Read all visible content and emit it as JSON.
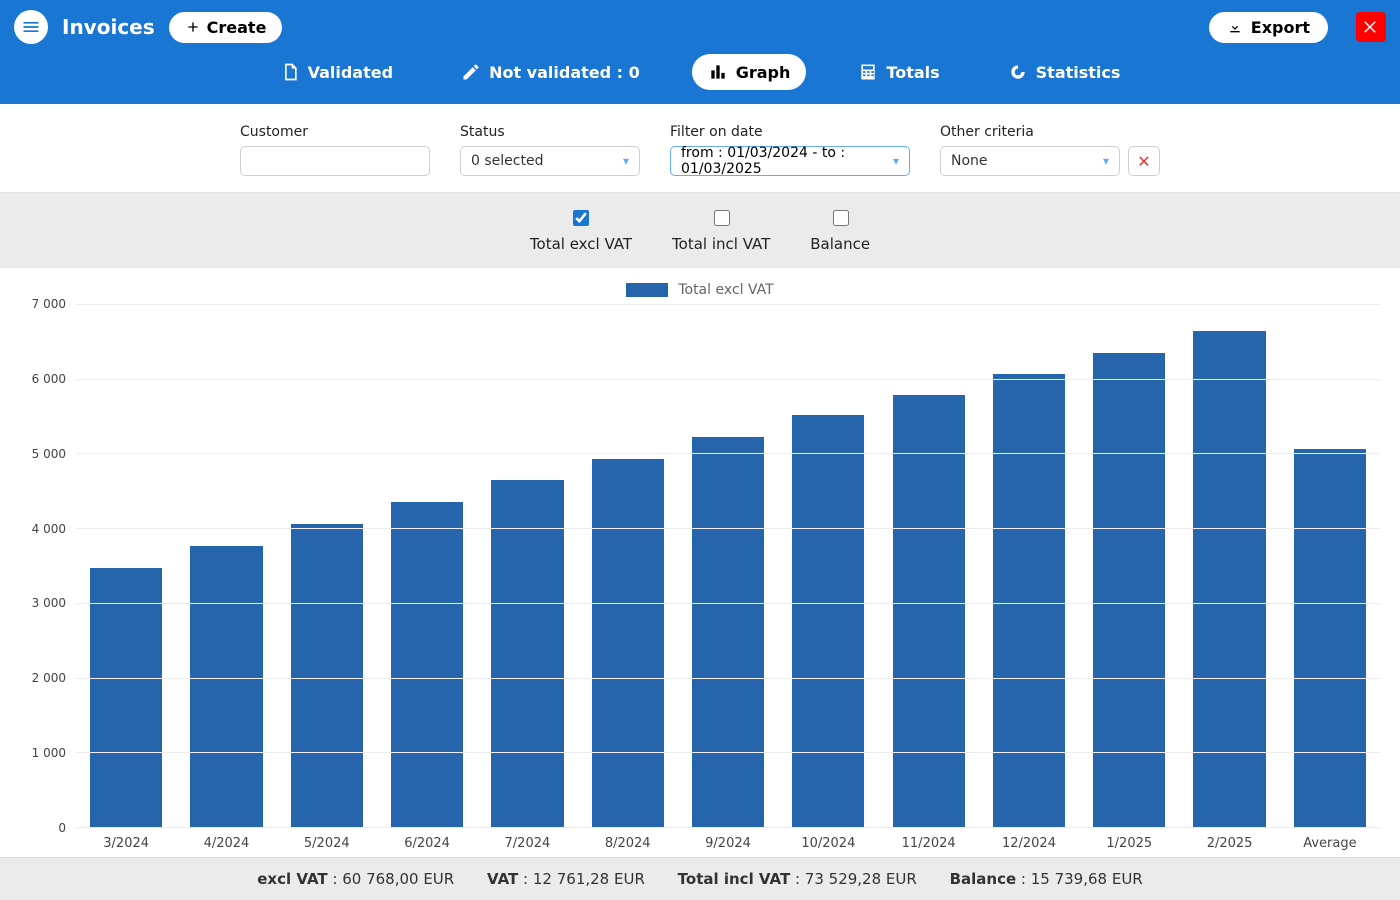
{
  "header": {
    "title": "Invoices",
    "create_label": "Create",
    "export_label": "Export"
  },
  "tabs": {
    "validated": "Validated",
    "not_validated": "Not validated : 0",
    "graph": "Graph",
    "totals": "Totals",
    "statistics": "Statistics",
    "active": "graph"
  },
  "filters": {
    "customer": {
      "label": "Customer",
      "value": ""
    },
    "status": {
      "label": "Status",
      "value": "0 selected"
    },
    "date": {
      "label": "Filter on date",
      "value": "from : 01/03/2024 - to : 01/03/2025"
    },
    "other": {
      "label": "Other criteria",
      "value": "None"
    }
  },
  "series_toggles": {
    "excl": {
      "label": "Total excl VAT",
      "checked": true
    },
    "incl": {
      "label": "Total incl VAT",
      "checked": false
    },
    "balance": {
      "label": "Balance",
      "checked": false
    }
  },
  "legend": {
    "series1": "Total excl VAT"
  },
  "footer": {
    "excl_label": "excl VAT",
    "excl_value": "60 768,00 EUR",
    "vat_label": "VAT",
    "vat_value": "12 761,28 EUR",
    "incl_label": "Total incl VAT",
    "incl_value": "73 529,28 EUR",
    "bal_label": "Balance",
    "bal_value": "15 739,68 EUR"
  },
  "chart_data": {
    "type": "bar",
    "title": "",
    "xlabel": "",
    "ylabel": "",
    "ylim": [
      0,
      7000
    ],
    "yticks": [
      0,
      1000,
      2000,
      3000,
      4000,
      5000,
      6000,
      7000
    ],
    "categories": [
      "3/2024",
      "4/2024",
      "5/2024",
      "6/2024",
      "7/2024",
      "8/2024",
      "9/2024",
      "10/2024",
      "11/2024",
      "12/2024",
      "1/2025",
      "2/2025",
      "Average"
    ],
    "series": [
      {
        "name": "Total excl VAT",
        "color": "#2664ab",
        "values": [
          3470,
          3760,
          4060,
          4350,
          4640,
          4930,
          5220,
          5510,
          5780,
          6060,
          6350,
          6640,
          5064
        ]
      }
    ]
  }
}
